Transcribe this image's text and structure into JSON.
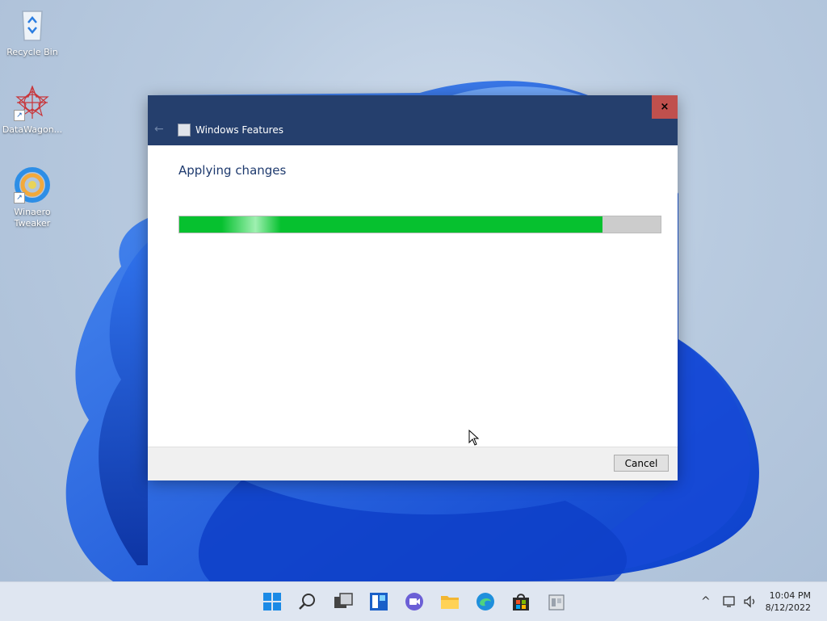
{
  "desktop": {
    "icons": [
      {
        "label": "Recycle Bin",
        "icon": "recycle-bin-icon"
      },
      {
        "label": "DataWagon...",
        "icon": "datawagon-icon"
      },
      {
        "label": "Winaero Tweaker",
        "icon": "winaero-tweaker-icon"
      }
    ]
  },
  "window": {
    "title": "Windows Features",
    "close_label": "×",
    "back_glyph": "←",
    "heading": "Applying changes",
    "progress_fraction": 0.88,
    "cancel_label": "Cancel"
  },
  "taskbar": {
    "apps": [
      "start-icon",
      "search-icon",
      "task-view-icon",
      "widgets-icon",
      "chat-icon",
      "file-explorer-icon",
      "edge-icon",
      "store-icon",
      "control-panel-icon"
    ],
    "clock_time": "10:04 PM",
    "clock_date": "8/12/2022"
  },
  "colors": {
    "titlebar": "#253f6d",
    "close": "#c0504d",
    "progress_fill": "#06c12f",
    "progress_track": "#cccccc",
    "heading_text": "#1e3a6e"
  }
}
